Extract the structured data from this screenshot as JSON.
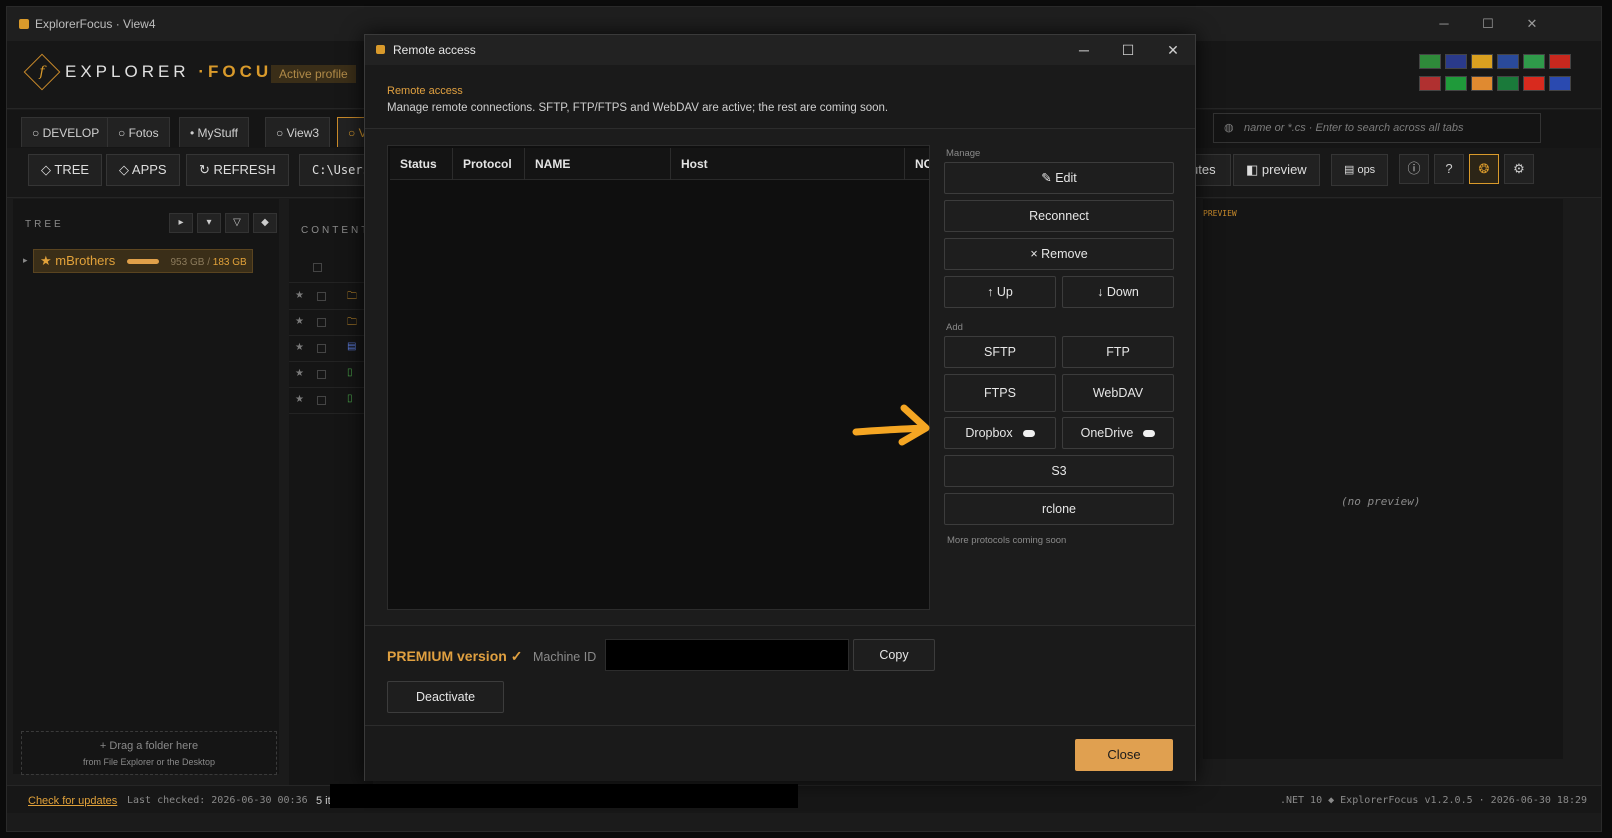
{
  "window": {
    "title": "ExplorerFocus · View4",
    "minimize": "─",
    "maximize": "☐",
    "close": "✕"
  },
  "header": {
    "logo_mark": "f",
    "logo_text_a": "EXPLORER ",
    "logo_text_b": "·FOCUS",
    "active_profile": "Active profile",
    "flags": [
      {
        "name": "portugal-flag",
        "color": "#2f8a3a"
      },
      {
        "name": "uk-flag",
        "color": "#2a3a8a"
      },
      {
        "name": "spain-flag",
        "color": "#d9a020"
      },
      {
        "name": "france-flag",
        "color": "#2a4a9a"
      },
      {
        "name": "italy-flag",
        "color": "#2f9a4a"
      },
      {
        "name": "germany-flag",
        "color": "#c8281e"
      },
      {
        "name": "usa-flag",
        "color": "#b03030"
      },
      {
        "name": "brazil-flag",
        "color": "#1f9a3a"
      },
      {
        "name": "india-flag",
        "color": "#e08a30"
      },
      {
        "name": "saudi-flag",
        "color": "#1a7a3a"
      },
      {
        "name": "china-flag",
        "color": "#d82a1e"
      },
      {
        "name": "russia-flag",
        "color": "#2a4ab0"
      }
    ]
  },
  "tabs": [
    {
      "label": "○ DEVELOP"
    },
    {
      "label": "○ Fotos"
    },
    {
      "label": "• MyStuff"
    },
    {
      "label": "○ View3"
    },
    {
      "label": "○ V"
    }
  ],
  "search": {
    "placeholder": "name or *.cs  ·  Enter to search across all tabs",
    "icon": "globe-icon"
  },
  "toolbar": {
    "tree": "◇ TREE",
    "apps": "◇ APPS",
    "refresh": "↻ REFRESH",
    "path": "C:\\Users",
    "attributes": "utes",
    "preview": "◧ preview",
    "ops": "▤ ops",
    "info": "ⓘ",
    "help": "?",
    "theme": "❂",
    "settings": "⚙"
  },
  "tree": {
    "label": "TREE",
    "controls": [
      "▸",
      "▾",
      "▽",
      "◆"
    ],
    "item": {
      "name": "mBrothers",
      "size_total": "953 GB",
      "sep": " / ",
      "size_free": "183 GB"
    },
    "drop_line1": "+ Drag a folder here",
    "drop_line2": "from File Explorer or the Desktop"
  },
  "contents": {
    "label": "CONTENTS",
    "rows": [
      {
        "star": "★",
        "icon": "folder-icon",
        "glyph": "🗀",
        "color": "#d99a2b"
      },
      {
        "star": "★",
        "icon": "folder-icon",
        "glyph": "🗀",
        "color": "#d99a2b"
      },
      {
        "star": "★",
        "icon": "document-icon",
        "glyph": "▤",
        "color": "#5a7ad9"
      },
      {
        "star": "★",
        "icon": "file-icon",
        "glyph": "▯",
        "color": "#4aa84a"
      },
      {
        "star": "★",
        "icon": "file-icon",
        "glyph": "▯",
        "color": "#4aa84a"
      }
    ]
  },
  "preview": {
    "label": "PREVIEW",
    "empty": "(no preview)"
  },
  "statusbar": {
    "check_updates": "Check for updates",
    "last_checked": "Last checked: 2026-06-30 00:36",
    "items": "5 ite",
    "right": ".NET 10  ◆ ExplorerFocus  v1.2.0.5  ·  2026-06-30  18:29"
  },
  "dialog": {
    "title": "Remote access",
    "heading": "Remote access",
    "description": "Manage remote connections. SFTP, FTP/FTPS and WebDAV are active; the rest are coming soon.",
    "columns": [
      "Status",
      "Protocol",
      "NAME",
      "Host",
      "NC"
    ],
    "manage_label": "Manage",
    "edit": "✎ Edit",
    "reconnect": "Reconnect",
    "remove": "× Remove",
    "up": "↑ Up",
    "down": "↓ Down",
    "add_label": "Add",
    "sftp": "SFTP",
    "ftp": "FTP",
    "ftps": "FTPS",
    "webdav": "WebDAV",
    "dropbox": "Dropbox",
    "onedrive": "OneDrive",
    "s3": "S3",
    "rclone": "rclone",
    "more_soon": "More protocols coming soon",
    "premium": "PREMIUM version ✓",
    "machine_id_label": "Machine ID",
    "copy": "Copy",
    "deactivate": "Deactivate",
    "close": "Close"
  },
  "colors": {
    "accent": "#d99a2b",
    "arrow": "#f5a623"
  }
}
